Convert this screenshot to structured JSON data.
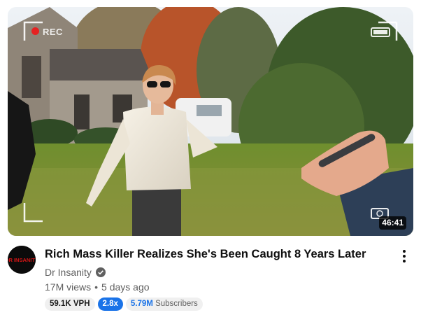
{
  "video": {
    "overlay_text": "REC",
    "duration": "46:41",
    "title": "Rich Mass Killer Realizes She's Been Caught 8 Years Later",
    "channel": "Dr Insanity",
    "views": "17M views",
    "age": "5 days ago",
    "avatar_text": "DR INSANITY"
  },
  "metrics": {
    "vph": "59.1K VPH",
    "multiplier": "2.8x",
    "subscribers_value": "5.79M",
    "subscribers_label": "Subscribers"
  },
  "colors": {
    "multiplier_bg": "#1a73e8",
    "subscribers_value": "#1a73e8",
    "avatar_text": "#d41414"
  },
  "icons": [
    "verified-check-icon",
    "more-vertical-icon",
    "record-dot-icon",
    "battery-icon",
    "camera-icon"
  ]
}
